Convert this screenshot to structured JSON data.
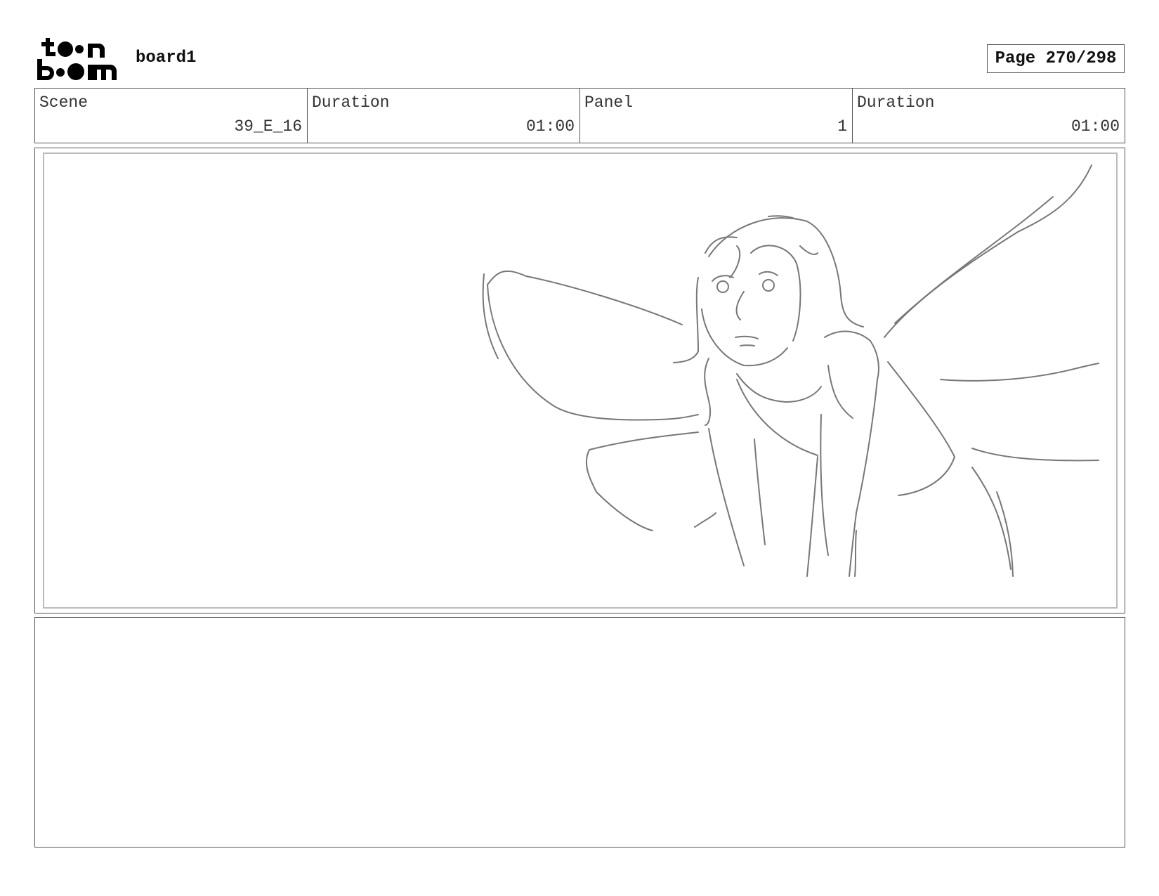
{
  "header": {
    "logo_text": "toon boom",
    "board_name": "board1",
    "page_label": "Page 270/298"
  },
  "info": {
    "scene_label": "Scene",
    "scene_value": "39_E_16",
    "duration_label": "Duration",
    "duration_value": "01:00",
    "panel_label": "Panel",
    "panel_value": "1",
    "panel_duration_label": "Duration",
    "panel_duration_value": "01:00"
  },
  "notes": {
    "text": ""
  }
}
